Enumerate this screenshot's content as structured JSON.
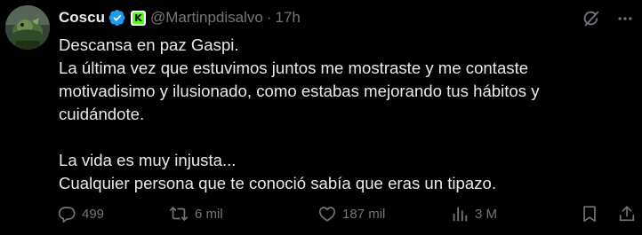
{
  "author": {
    "name": "Coscu",
    "handle": "@Martinpdisalvo",
    "separator": "·",
    "time": "17h",
    "affiliate_badge_letter": "K",
    "verified_color": "#1d9bf0",
    "affiliate_color": "#53fc18"
  },
  "tweet": {
    "lines": [
      "Descansa en paz Gaspi.",
      "La última vez que estuvimos juntos me mostraste y me contaste",
      "motivadisimo y ilusionado, como estabas mejorando tus hábitos y",
      "cuidándote.",
      "",
      "La vida es muy injusta...",
      "Cualquier persona que te conoció sabía que eras un tipazo."
    ]
  },
  "actions": {
    "replies": "499",
    "retweets": "6 mil",
    "likes": "187 mil",
    "views": "3 M"
  },
  "icons": {
    "reply": "reply-icon",
    "retweet": "retweet-icon",
    "like": "heart-icon",
    "views": "views-icon",
    "bookmark": "bookmark-icon",
    "share": "share-icon",
    "grok": "grok-icon",
    "more": "more-icon"
  },
  "colors": {
    "background": "#000000",
    "text": "#e7e9ea",
    "secondary": "#71767b"
  }
}
